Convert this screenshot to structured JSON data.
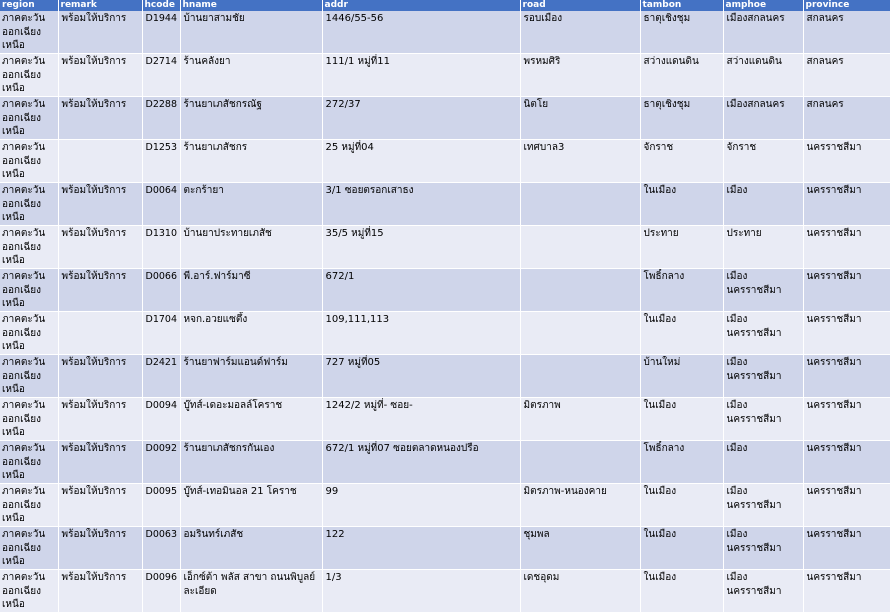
{
  "columns": [
    "region",
    "remark",
    "hcode",
    "hname",
    "addr",
    "road",
    "tambon",
    "amphoe",
    "province"
  ],
  "rows": [
    {
      "region": "ภาคตะวันออกเฉียงเหนือ",
      "remark": "พร้อมให้บริการ",
      "hcode": "D1944",
      "hname": "บ้านยาสามชัย",
      "addr": "1446/55-56",
      "road": "รอบเมือง",
      "tambon": "ธาตุเชิงชุม",
      "amphoe": "เมืองสกลนคร",
      "province": "สกลนคร"
    },
    {
      "region": "ภาคตะวันออกเฉียงเหนือ",
      "remark": "พร้อมให้บริการ",
      "hcode": "D2714",
      "hname": "ร้านคลังยา",
      "addr": "111/1 หมู่ที่11",
      "road": "พรหมศิริ",
      "tambon": "สว่างแดนดิน",
      "amphoe": "สว่างแดนดิน",
      "province": "สกลนคร"
    },
    {
      "region": "ภาคตะวันออกเฉียงเหนือ",
      "remark": "พร้อมให้บริการ",
      "hcode": "D2288",
      "hname": "ร้านยาเภสัชกรณัฐ",
      "addr": "272/37",
      "road": "นิตโย",
      "tambon": "ธาตุเชิงชุม",
      "amphoe": "เมืองสกลนคร",
      "province": "สกลนคร"
    },
    {
      "region": "ภาคตะวันออกเฉียงเหนือ",
      "remark": "",
      "hcode": "D1253",
      "hname": "ร้านยาเภสัชกร",
      "addr": "25 หมู่ที่04",
      "road": "เทศบาล3",
      "tambon": "จักราช",
      "amphoe": "จักราช",
      "province": "นครราชสีมา"
    },
    {
      "region": "ภาคตะวันออกเฉียงเหนือ",
      "remark": "พร้อมให้บริการ",
      "hcode": "D0064",
      "hname": "ตะกร้ายา",
      "addr": "3/1 ซอยตรอกเสาธง",
      "road": "",
      "tambon": "ในเมือง",
      "amphoe": "เมือง",
      "province": "นครราชสีมา"
    },
    {
      "region": "ภาคตะวันออกเฉียงเหนือ",
      "remark": "พร้อมให้บริการ",
      "hcode": "D1310",
      "hname": "บ้านยาประทายเภสัช",
      "addr": "35/5 หมู่ที่15",
      "road": "",
      "tambon": "ประทาย",
      "amphoe": "ประทาย",
      "province": "นครราชสีมา"
    },
    {
      "region": "ภาคตะวันออกเฉียงเหนือ",
      "remark": "พร้อมให้บริการ",
      "hcode": "D0066",
      "hname": "พี.อาร์.ฟาร์มาซี",
      "addr": "672/1",
      "road": "",
      "tambon": "โพธิ์กลาง",
      "amphoe": "เมืองนครราชสีมา",
      "province": "นครราชสีมา"
    },
    {
      "region": "ภาคตะวันออกเฉียงเหนือ",
      "remark": "",
      "hcode": "D1704",
      "hname": "หจก.อวยแซตึ้ง",
      "addr": "109,111,113",
      "road": "",
      "tambon": "ในเมือง",
      "amphoe": "เมืองนครราชสีมา",
      "province": "นครราชสีมา"
    },
    {
      "region": "ภาคตะวันออกเฉียงเหนือ",
      "remark": "พร้อมให้บริการ",
      "hcode": "D2421",
      "hname": "ร้านยาฟาร์มแอนด์ฟาร์ม",
      "addr": "727 หมู่ที่05",
      "road": "",
      "tambon": "บ้านใหม่",
      "amphoe": "เมืองนครราชสีมา",
      "province": "นครราชสีมา"
    },
    {
      "region": "ภาคตะวันออกเฉียงเหนือ",
      "remark": "พร้อมให้บริการ",
      "hcode": "D0094",
      "hname": "บู๊ทส์-เดอะมอลล์โคราช",
      "addr": "1242/2 หมู่ที่- ซอย-",
      "road": "มิตรภาพ",
      "tambon": "ในเมือง",
      "amphoe": "เมืองนครราชสีมา",
      "province": "นครราชสีมา"
    },
    {
      "region": "ภาคตะวันออกเฉียงเหนือ",
      "remark": "พร้อมให้บริการ",
      "hcode": "D0092",
      "hname": "ร้านยาเภสัชกรกันเอง",
      "addr": "672/1 หมู่ที่07 ซอยตลาดหนองปรือ",
      "road": "",
      "tambon": "โพธิ์กลาง",
      "amphoe": "เมือง",
      "province": "นครราชสีมา"
    },
    {
      "region": "ภาคตะวันออกเฉียงเหนือ",
      "remark": "พร้อมให้บริการ",
      "hcode": "D0095",
      "hname": "บู๊ทส์-เทอมินอล 21 โคราช",
      "addr": "99",
      "road": "มิตรภาพ-หนองคาย",
      "tambon": "ในเมือง",
      "amphoe": "เมืองนครราชสีมา",
      "province": "นครราชสีมา"
    },
    {
      "region": "ภาคตะวันออกเฉียงเหนือ",
      "remark": "พร้อมให้บริการ",
      "hcode": "D0063",
      "hname": "อมรินทร์เภสัช",
      "addr": "122",
      "road": "ชุมพล",
      "tambon": "ในเมือง",
      "amphoe": "เมืองนครราชสีมา",
      "province": "นครราชสีมา"
    },
    {
      "region": "ภาคตะวันออกเฉียงเหนือ",
      "remark": "พร้อมให้บริการ",
      "hcode": "D0096",
      "hname": "เอ็กซ์ต้า พลัส สาขา ถนนพิบูลย์ละเอียด",
      "addr": "1/3",
      "road": "เดชอุดม",
      "tambon": "ในเมือง",
      "amphoe": "เมืองนครราชสีมา",
      "province": "นครราชสีมา"
    }
  ]
}
